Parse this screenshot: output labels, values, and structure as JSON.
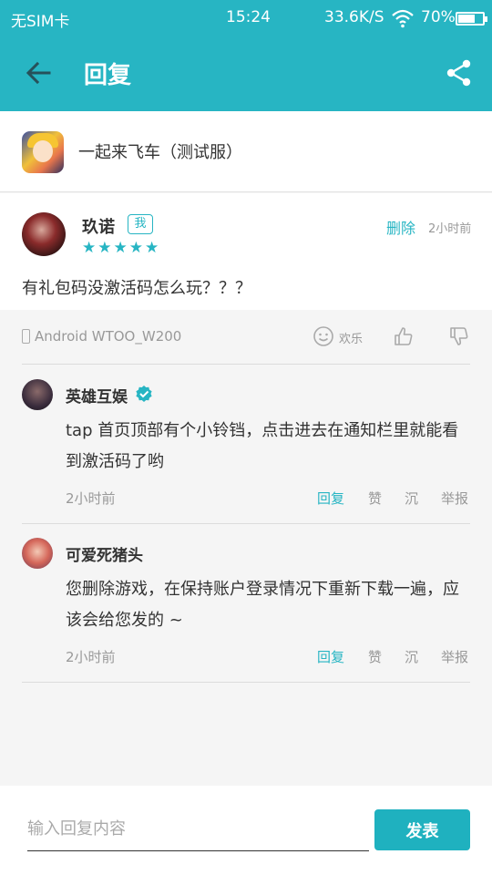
{
  "status_bar": {
    "carrier": "无SIM卡",
    "time": "15:24",
    "speed": "33.6K/S",
    "battery": "70%",
    "battery_level": 0.7
  },
  "app_bar": {
    "title": "回复"
  },
  "game": {
    "name": "一起来飞车（测试服）"
  },
  "post": {
    "username": "玖诺",
    "me_badge": "我",
    "stars": "★★★★★",
    "delete_label": "删除",
    "time": "2小时前",
    "content": "有礼包码没激活码怎么玩？？？",
    "device": "Android WTOO_W200",
    "reaction_label": "欢乐"
  },
  "replies": [
    {
      "name": "英雄互娱",
      "verified": true,
      "text": "tap 首页顶部有个小铃铛，点击进去在通知栏里就能看到激活码了哟",
      "time": "2小时前",
      "reply_label": "回复",
      "like_label": "赞",
      "sink_label": "沉",
      "report_label": "举报"
    },
    {
      "name": "可爱死猪头",
      "verified": false,
      "text": "您删除游戏，在保持账户登录情况下重新下载一遍，应该会给您发的 ~",
      "time": "2小时前",
      "reply_label": "回复",
      "like_label": "赞",
      "sink_label": "沉",
      "report_label": "举报"
    }
  ],
  "input": {
    "placeholder": "输入回复内容",
    "value": "",
    "send_label": "发表"
  },
  "colors": {
    "accent": "#27b5c3",
    "text": "#333333",
    "muted": "#999999"
  }
}
